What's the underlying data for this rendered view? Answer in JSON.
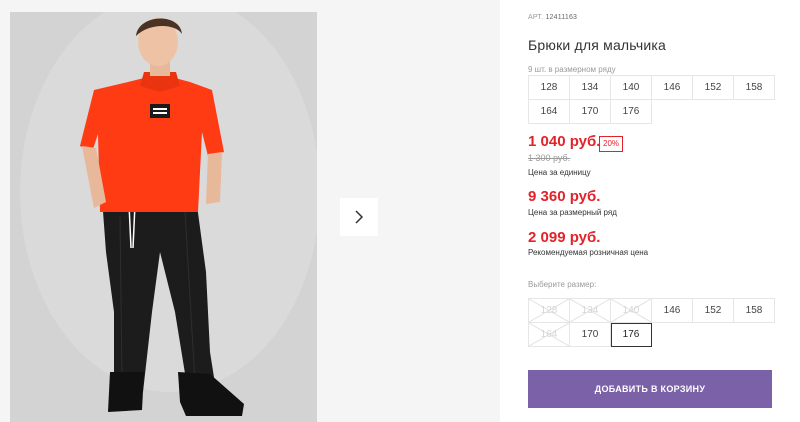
{
  "gallery": {
    "next_icon": "chevron-right-icon"
  },
  "product": {
    "article_label": "АРТ.",
    "article_value": "12411163",
    "title": "Брюки для мальчика",
    "series_label": "9 шт. в размерном ряду",
    "series_sizes": [
      "128",
      "134",
      "140",
      "146",
      "152",
      "158",
      "164",
      "170",
      "176"
    ],
    "price_main": "1 040 руб.",
    "discount": "20%",
    "price_old": "1 300 руб.",
    "price_main_caption": "Цена за единицу",
    "price_series": "9 360 руб.",
    "price_series_caption": "Цена за размерный ряд",
    "price_retail": "2 099 руб.",
    "price_retail_caption": "Рекомендуемая розничная цена",
    "choose_size_label": "Выберите размер:",
    "select_sizes": [
      {
        "label": "128",
        "available": false
      },
      {
        "label": "134",
        "available": false
      },
      {
        "label": "140",
        "available": false
      },
      {
        "label": "146",
        "available": true
      },
      {
        "label": "152",
        "available": true
      },
      {
        "label": "158",
        "available": true
      },
      {
        "label": "164",
        "available": false
      },
      {
        "label": "170",
        "available": true
      },
      {
        "label": "176",
        "available": true,
        "selected": true
      }
    ],
    "add_to_cart": "ДОБАВИТЬ В КОРЗИНУ"
  },
  "colors": {
    "price_red": "#e2232b",
    "cta_purple": "#7b61a8",
    "shirt": "#ff3b14",
    "trousers": "#1c1c1c"
  }
}
